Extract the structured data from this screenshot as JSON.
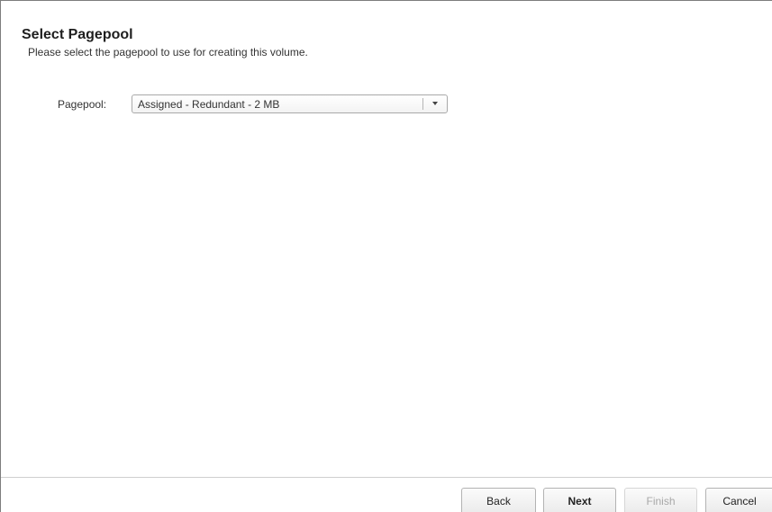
{
  "header": {
    "title": "Select Pagepool",
    "subtitle": "Please select the pagepool to use for creating this volume."
  },
  "form": {
    "pagepool_label": "Pagepool:",
    "pagepool_value": "Assigned - Redundant - 2 MB"
  },
  "footer": {
    "back_label": "Back",
    "next_label": "Next",
    "finish_label": "Finish",
    "cancel_label": "Cancel",
    "finish_enabled": false
  },
  "icons": {
    "dropdown": "chevron-down-icon"
  },
  "colors": {
    "disabled_text": "#a8a8a8",
    "border": "#b3b3b3"
  }
}
